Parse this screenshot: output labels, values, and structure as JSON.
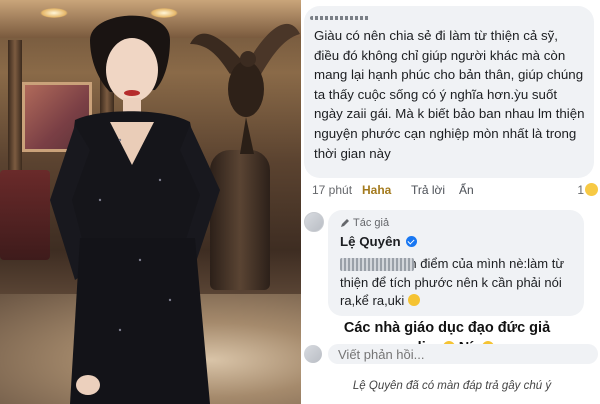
{
  "photo": {
    "alt": "Lệ Quyên in black sequin dress"
  },
  "comment": {
    "text": "Giàu có nên chia sẻ đi làm từ thiện cả sỹ, điều đó không chỉ giúp người khác mà còn mang lại hạnh phúc cho bản thân, giúp chúng ta thấy cuộc sống có ý nghĩa hơn.ỳu suốt ngày zaii gái. Mà k biết bảo ban nhau lm thiện nguyện phước cạn nghiệp mòn nhất là trong thời gian này",
    "time": "17 phút",
    "reaction": "Haha",
    "reply_label": "Trả lời",
    "hide_label": "Ẩn",
    "reaction_count": "1"
  },
  "reply": {
    "author_badge": "Tác giả",
    "author_name": "Lệ Quyên",
    "text_part1": "Biết tôn quan điểm của mình nè:làm từ thiện để tích phước nên k cần phải nói ra,kể ra,uki"
  },
  "sticker": {
    "line1": "Các nhà giáo dục đạo đức giả",
    "line2_prefix": "online",
    "line2_word": "Nín"
  },
  "reply_input": {
    "placeholder": "Viết phản hồi..."
  },
  "caption": "Lệ Quyên đã có màn đáp trả gây chú ý",
  "colors": {
    "haha": "#a37a1d",
    "verified": "#1877f2",
    "bubble": "#f0f2f5"
  }
}
